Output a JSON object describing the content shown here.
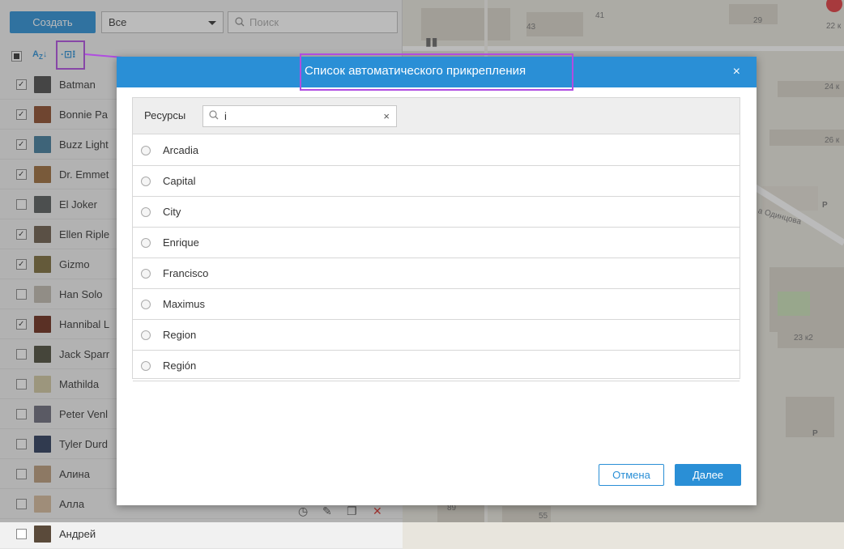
{
  "toolbar": {
    "create_label": "Создать",
    "filter_value": "Все",
    "search_placeholder": "Поиск"
  },
  "units": [
    {
      "name": "Batman",
      "checked": true,
      "thumb": "#4a4a4a"
    },
    {
      "name": "Bonnie Pa",
      "checked": true,
      "thumb": "#8a4b2a"
    },
    {
      "name": "Buzz Light",
      "checked": true,
      "thumb": "#3f7a9a"
    },
    {
      "name": "Dr. Emmet",
      "checked": true,
      "thumb": "#9a6a3a"
    },
    {
      "name": "El Joker",
      "checked": false,
      "thumb": "#555a5a"
    },
    {
      "name": "Ellen Riple",
      "checked": true,
      "thumb": "#6a5b4a"
    },
    {
      "name": "Gizmo",
      "checked": true,
      "thumb": "#7a6a3a"
    },
    {
      "name": "Han Solo",
      "checked": false,
      "thumb": "#bfb9ae"
    },
    {
      "name": "Hannibal L",
      "checked": true,
      "thumb": "#6a2a1a"
    },
    {
      "name": "Jack Sparr",
      "checked": false,
      "thumb": "#4a4a3a"
    },
    {
      "name": "Mathilda",
      "checked": false,
      "thumb": "#cfc6a0"
    },
    {
      "name": "Peter Venl",
      "checked": false,
      "thumb": "#6a6a7a"
    },
    {
      "name": "Tyler Durd",
      "checked": false,
      "thumb": "#2a3a5a"
    },
    {
      "name": "Алина",
      "checked": false,
      "thumb": "#b89a7a"
    },
    {
      "name": "Алла",
      "checked": false,
      "thumb": "#d4b89a"
    },
    {
      "name": "Андрей",
      "checked": false,
      "thumb": "#5a4a3a"
    }
  ],
  "map_labels": [
    "41",
    "43",
    "29",
    "22 к",
    "24 к",
    "26 к",
    "Р",
    "а Одинцова",
    "23 к2",
    "Р",
    "89",
    "55"
  ],
  "dialog": {
    "title": "Список автоматического прикрепления",
    "close_symbol": "×",
    "resources_label": "Ресурсы",
    "search_value": "i",
    "clear_symbol": "×",
    "resources": [
      "Arcadia",
      "Capital",
      "City",
      "Enrique",
      "Francisco",
      "Maximus",
      "Region",
      "Región"
    ],
    "cancel_label": "Отмена",
    "next_label": "Далее"
  },
  "colors": {
    "accent": "#2a8fd6",
    "highlight": "#b04de0"
  }
}
